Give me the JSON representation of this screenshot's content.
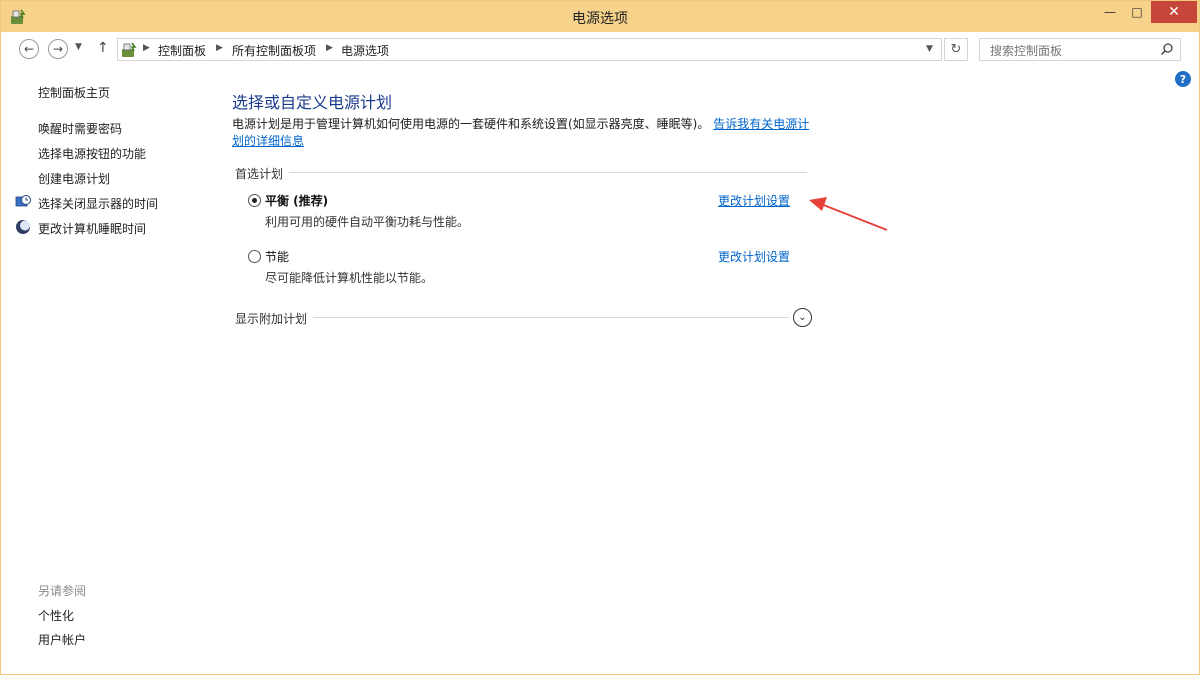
{
  "window": {
    "title": "电源选项",
    "minimize": "—",
    "maximize": "□",
    "close": "✕"
  },
  "address": {
    "crumbs": [
      "控制面板",
      "所有控制面板项",
      "电源选项"
    ],
    "search_placeholder": "搜索控制面板"
  },
  "left_pane": {
    "home": "控制面板主页",
    "links": [
      "唤醒时需要密码",
      "选择电源按钮的功能",
      "创建电源计划",
      "选择关闭显示器的时间",
      "更改计算机睡眠时间"
    ],
    "see_also_title": "另请参阅",
    "see_also": [
      "个性化",
      "用户帐户"
    ]
  },
  "main": {
    "title": "选择或自定义电源计划",
    "description": "电源计划是用于管理计算机如何使用电源的一套硬件和系统设置(如显示器亮度、睡眠等)。",
    "description_link": "告诉我有关电源计划的详细信息",
    "preferred_label": "首选计划",
    "plans": [
      {
        "name": "平衡 (推荐)",
        "desc": "利用可用的硬件自动平衡功耗与性能。",
        "link": "更改计划设置",
        "selected": true
      },
      {
        "name": "节能",
        "desc": "尽可能降低计算机性能以节能。",
        "link": "更改计划设置",
        "selected": false
      }
    ],
    "additional_label": "显示附加计划"
  },
  "colors": {
    "titlebar": "#f6d28b",
    "link": "#0066cc",
    "heading": "#1c3c8e",
    "annotation_arrow": "#e8413a"
  }
}
